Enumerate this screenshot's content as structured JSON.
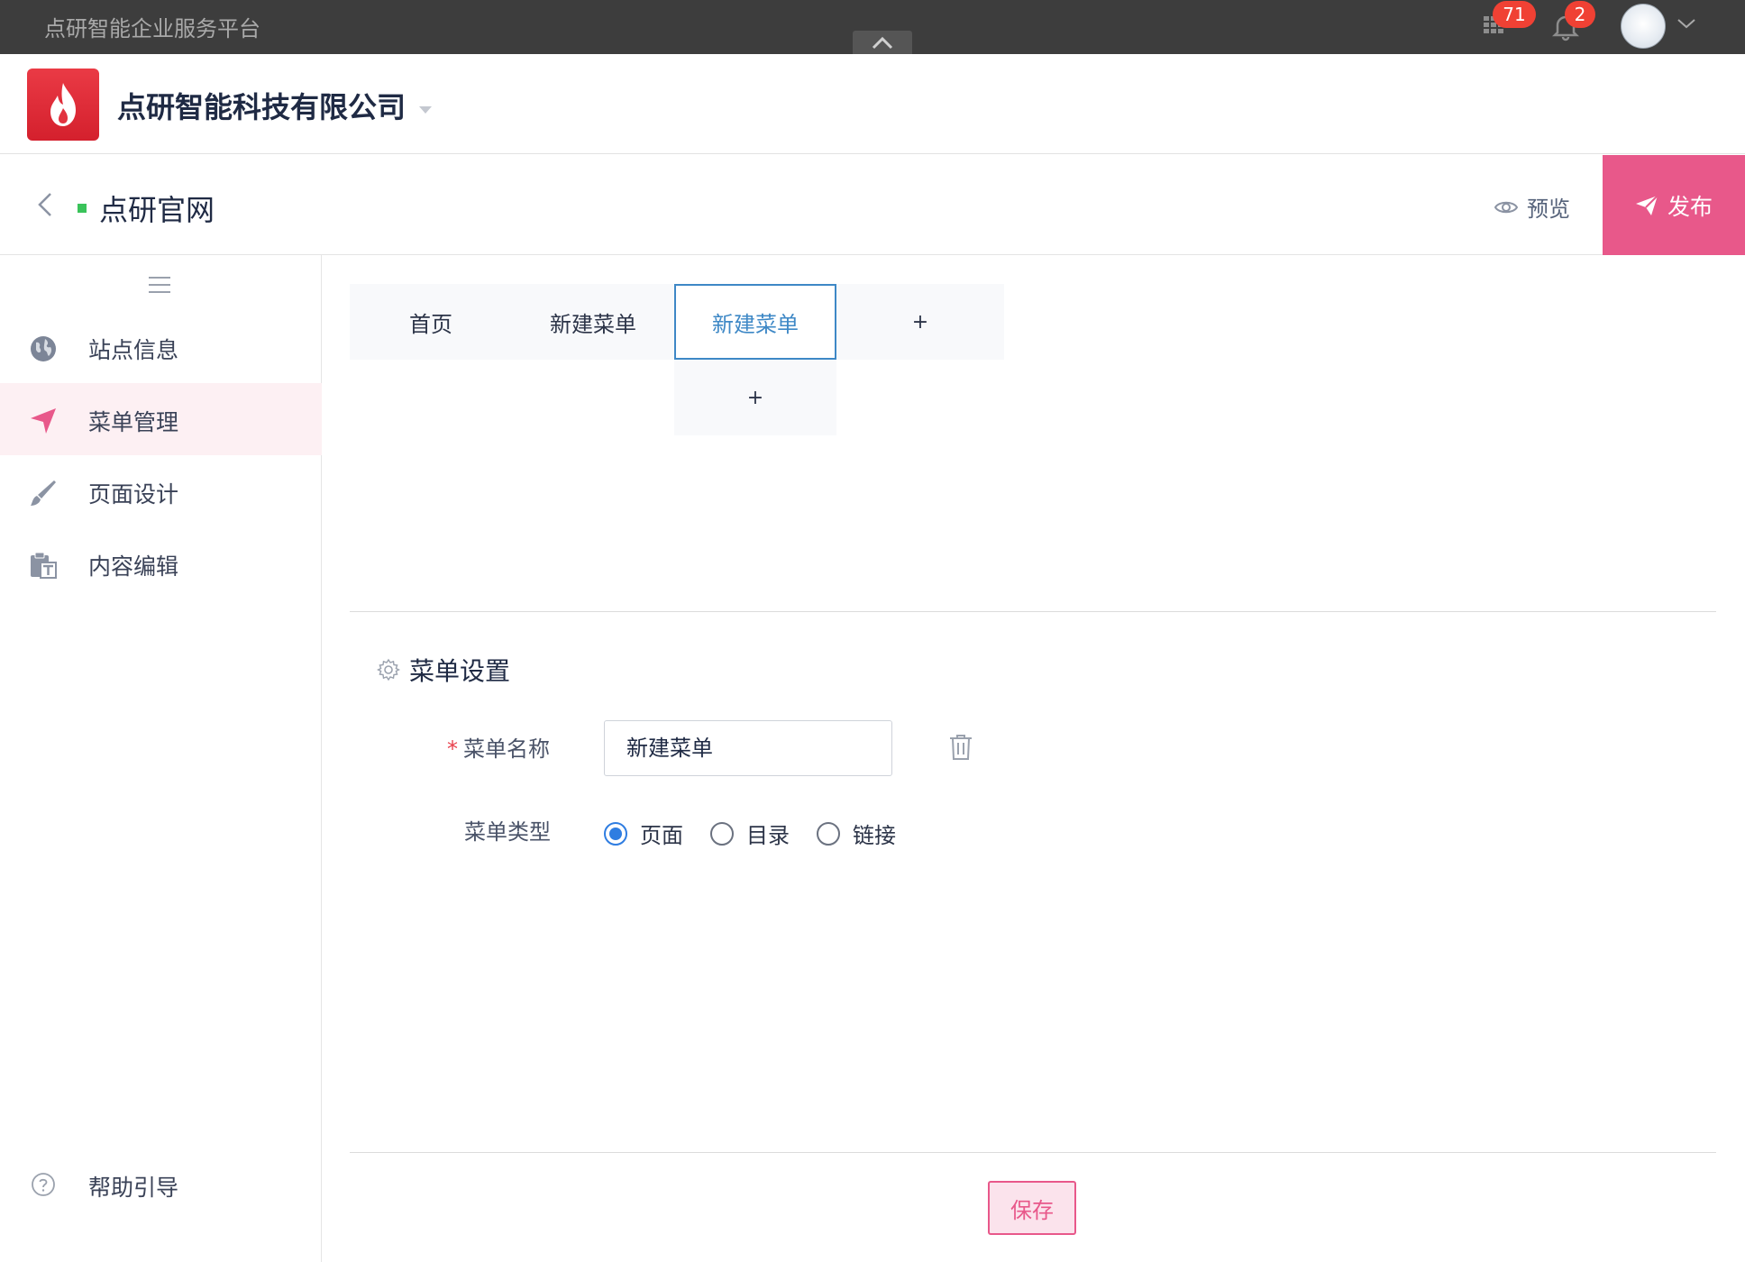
{
  "topbar": {
    "platform_name": "点研智能企业服务平台",
    "apps_badge": "71",
    "notifications_badge": "2"
  },
  "header": {
    "company_name": "点研智能科技有限公司"
  },
  "subheader": {
    "site_name": "点研官网",
    "preview_label": "预览",
    "publish_label": "发布"
  },
  "sidebar": {
    "items": [
      {
        "label": "站点信息",
        "icon": "globe-icon"
      },
      {
        "label": "菜单管理",
        "icon": "send-icon",
        "active": true
      },
      {
        "label": "页面设计",
        "icon": "brush-icon"
      },
      {
        "label": "内容编辑",
        "icon": "text-clipboard-icon"
      }
    ],
    "help_label": "帮助引导"
  },
  "menu_tabs": {
    "items": [
      "首页",
      "新建菜单",
      "新建菜单"
    ],
    "selected_index": 2,
    "add_label": "+",
    "sub_add_label": "+"
  },
  "settings": {
    "title": "菜单设置",
    "name_label": "菜单名称",
    "name_required_mark": "*",
    "name_value": "新建菜单",
    "type_label": "菜单类型",
    "type_options": [
      "页面",
      "目录",
      "链接"
    ],
    "type_selected": "页面",
    "save_label": "保存"
  },
  "colors": {
    "accent_pink": "#e8588a",
    "selected_blue": "#3e88c6",
    "topbar_bg": "#3d3d3d",
    "status_green": "#3ac35a"
  }
}
